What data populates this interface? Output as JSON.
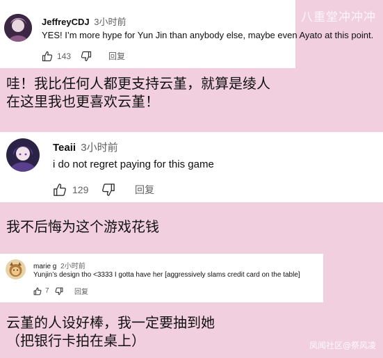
{
  "watermark": "八重堂冲冲冲",
  "credit": "凤闻社区@祭风凌",
  "comments": [
    {
      "author": "JeffreyCDJ",
      "time": "3小时前",
      "text": "YES! I’m more hype for Yun Jin than anybody else, maybe even Ayato at this point.",
      "likes": "143",
      "reply": "回复",
      "translation": [
        "哇！我比任何人都更支持云堇，就算是绫人",
        "在这里我也更喜欢云堇！"
      ]
    },
    {
      "author": "Teaii",
      "time": "3小时前",
      "text": "i do not regret paying for this game",
      "likes": "129",
      "reply": "回复",
      "translation": [
        "我不后悔为这个游戏花钱"
      ]
    },
    {
      "author": "marie g",
      "time": "2小时前",
      "text": "Yunjin’s design tho <3333 I gotta have her [aggressively slams credit card on the table]",
      "likes": "7",
      "reply": "回复",
      "translation": [
        "云堇的人设好棒，我一定要抽到她",
        "（把银行卡拍在桌上）"
      ]
    }
  ]
}
